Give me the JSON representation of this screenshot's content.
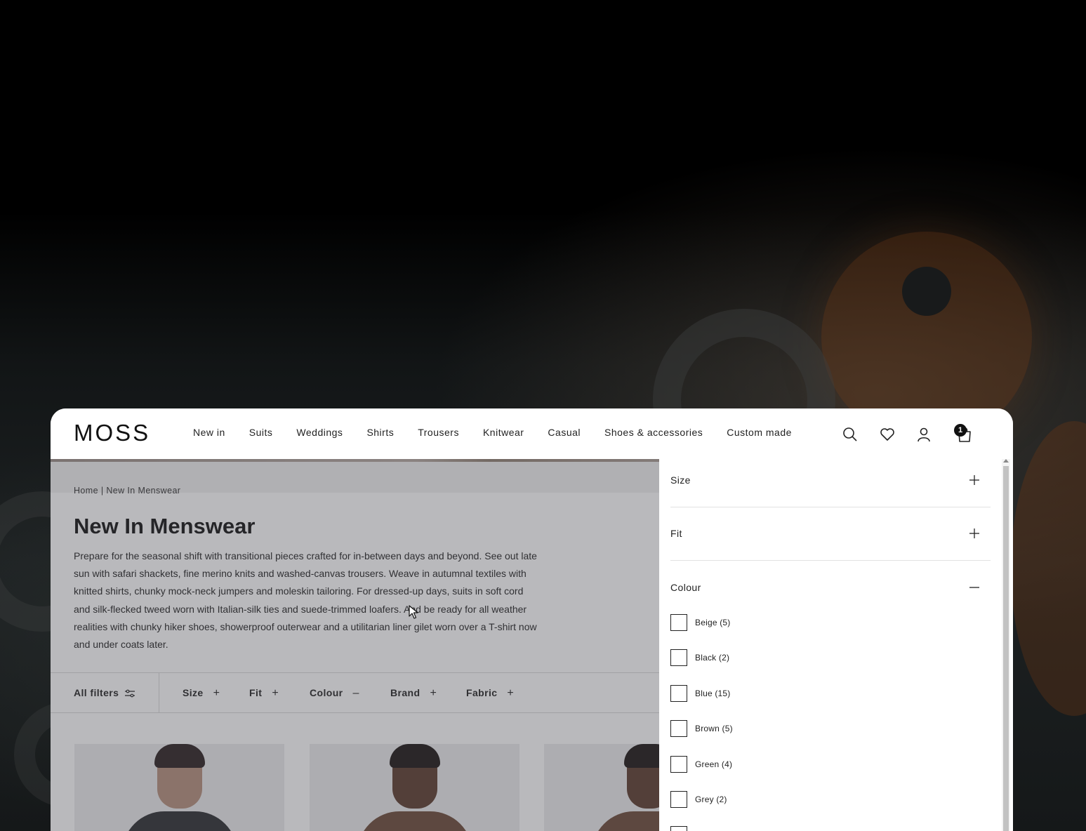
{
  "header": {
    "logo": "MOSS",
    "nav": [
      {
        "label": "New in"
      },
      {
        "label": "Suits"
      },
      {
        "label": "Weddings"
      },
      {
        "label": "Shirts"
      },
      {
        "label": "Trousers"
      },
      {
        "label": "Knitwear"
      },
      {
        "label": "Casual"
      },
      {
        "label": "Shoes & accessories"
      },
      {
        "label": "Custom made"
      }
    ],
    "icons": [
      "search-icon",
      "heart-icon",
      "user-icon",
      "bag-icon"
    ],
    "bag_count": "1"
  },
  "breadcrumb": "Home | New In Menswear",
  "page": {
    "title": "New In Menswear",
    "description": "Prepare for the seasonal shift with transitional pieces crafted for in-between days and beyond. See out late sun with safari shackets, fine merino knits and washed-canvas trousers. Weave in autumnal textiles with knitted shirts, chunky mock-neck jumpers and moleskin tailoring. For dressed-up days, suits in soft cord and silk-flecked tweed worn with Italian-silk ties and suede-trimmed loafers. And be ready for all weather realities with chunky hiker shoes, showerproof outerwear and a utilitarian liner gilet worn over a T-shirt now and under coats later."
  },
  "filterbar": {
    "all_filters": "All filters",
    "filters": [
      {
        "label": "Size",
        "symbol": "+"
      },
      {
        "label": "Fit",
        "symbol": "+"
      },
      {
        "label": "Colour",
        "symbol": "–"
      },
      {
        "label": "Brand",
        "symbol": "+"
      },
      {
        "label": "Fabric",
        "symbol": "+"
      }
    ]
  },
  "drawer": {
    "sections": [
      {
        "label": "Size",
        "state": "collapsed"
      },
      {
        "label": "Fit",
        "state": "collapsed"
      },
      {
        "label": "Colour",
        "state": "expanded"
      }
    ],
    "colour_options": [
      {
        "label": "Beige (5)"
      },
      {
        "label": "Black (2)"
      },
      {
        "label": "Blue (15)"
      },
      {
        "label": "Brown (5)"
      },
      {
        "label": "Green (4)"
      },
      {
        "label": "Grey (2)"
      }
    ]
  },
  "colors": {
    "text": "#222222",
    "overlay": "#4b4b55",
    "background": "#000000"
  }
}
